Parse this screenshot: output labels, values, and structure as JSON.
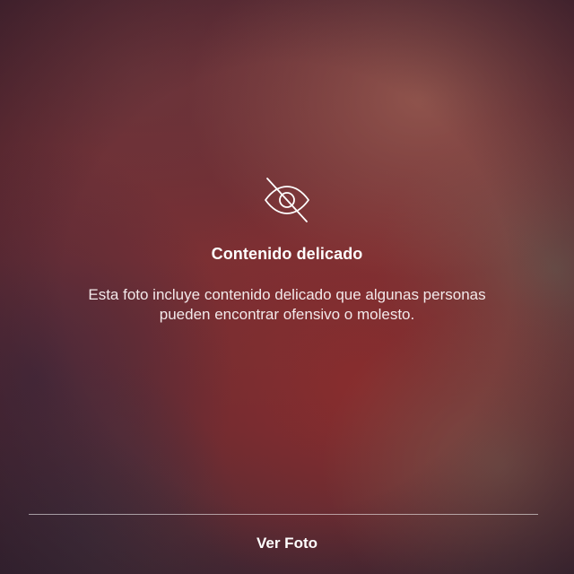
{
  "warning": {
    "icon": "eye-slash-icon",
    "title": "Contenido delicado",
    "description_line1": "Esta foto incluye contenido delicado que algunas personas",
    "description_line2": "pueden encontrar ofensivo o molesto."
  },
  "action": {
    "view_label": "Ver Foto"
  },
  "colors": {
    "text": "#ffffff",
    "background_tint": "#6a2f35"
  }
}
